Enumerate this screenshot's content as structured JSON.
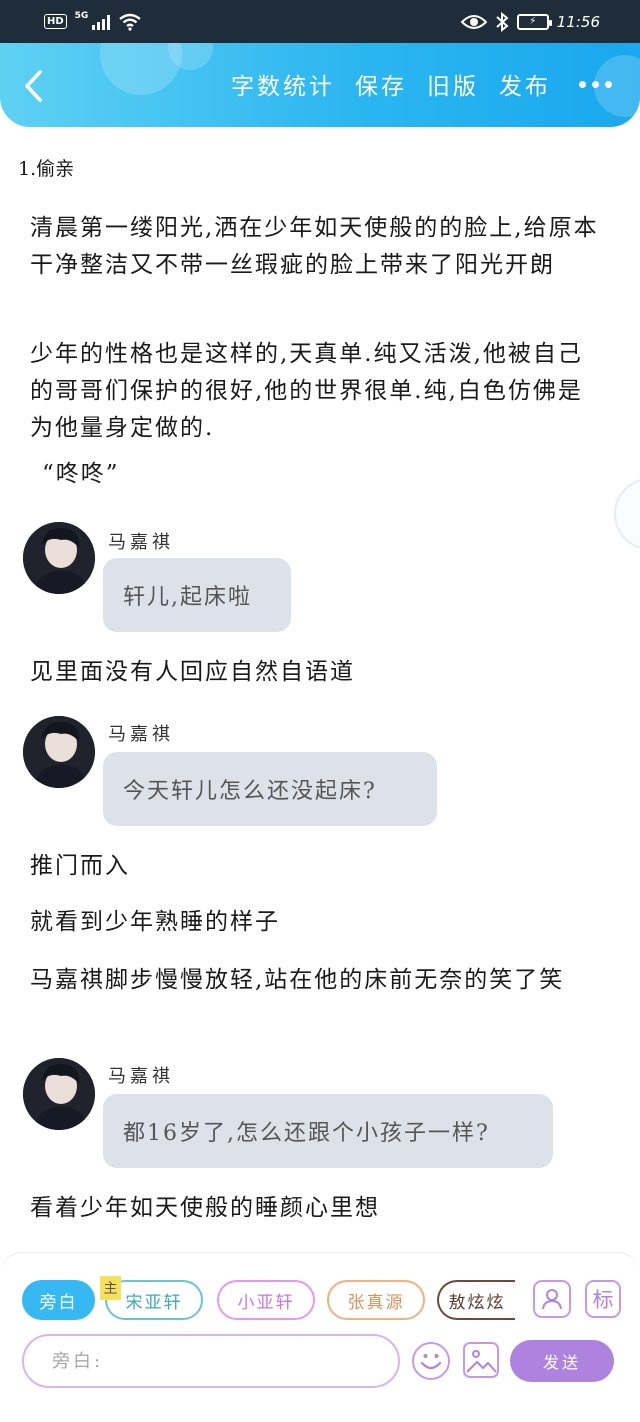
{
  "status_bar": {
    "hd_badge": "HD",
    "network": "5G",
    "time": "11:56"
  },
  "header": {
    "actions": [
      {
        "label": "字数统计"
      },
      {
        "label": "保存"
      },
      {
        "label": "旧版"
      },
      {
        "label": "发布"
      }
    ]
  },
  "story": {
    "chapter_title": "1.偷亲",
    "paragraphs": [
      "清晨第一缕阳光,洒在少年如天使般的的脸上,给原本干净整洁又不带一丝瑕疵的脸上带来了阳光开朗",
      "少年的性格也是这样的,天真单.纯又活泼,他被自己的哥哥们保护的很好,他的世界很单.纯,白色仿佛是为他量身定做的.",
      "“咚咚”",
      "见里面没有人回应自然自语道",
      "推门而入",
      "就看到少年熟睡的样子",
      "马嘉祺脚步慢慢放轻,站在他的床前无奈的笑了笑",
      "看着少年如天使般的睡颜心里想"
    ],
    "dialogues": [
      {
        "speaker": "马嘉祺",
        "text": "轩儿,起床啦"
      },
      {
        "speaker": "马嘉祺",
        "text": "今天轩儿怎么还没起床?"
      },
      {
        "speaker": "马嘉祺",
        "text": "都16岁了,怎么还跟个小孩子一样?"
      }
    ]
  },
  "editor": {
    "roles": [
      {
        "label": "旁白"
      },
      {
        "label": "宋亚轩"
      },
      {
        "label": "小亚轩"
      },
      {
        "label": "张真源"
      },
      {
        "label": "敖炫炫"
      }
    ],
    "main_tag": "主",
    "mark_tool": "标",
    "input_placeholder": "旁白:",
    "send_label": "发送"
  },
  "colors": {
    "header_accent": "#2cb6f0",
    "active_role": "#36b8f2",
    "send_button": "#ae83e0",
    "bubble_bg": "#dde2ea"
  }
}
